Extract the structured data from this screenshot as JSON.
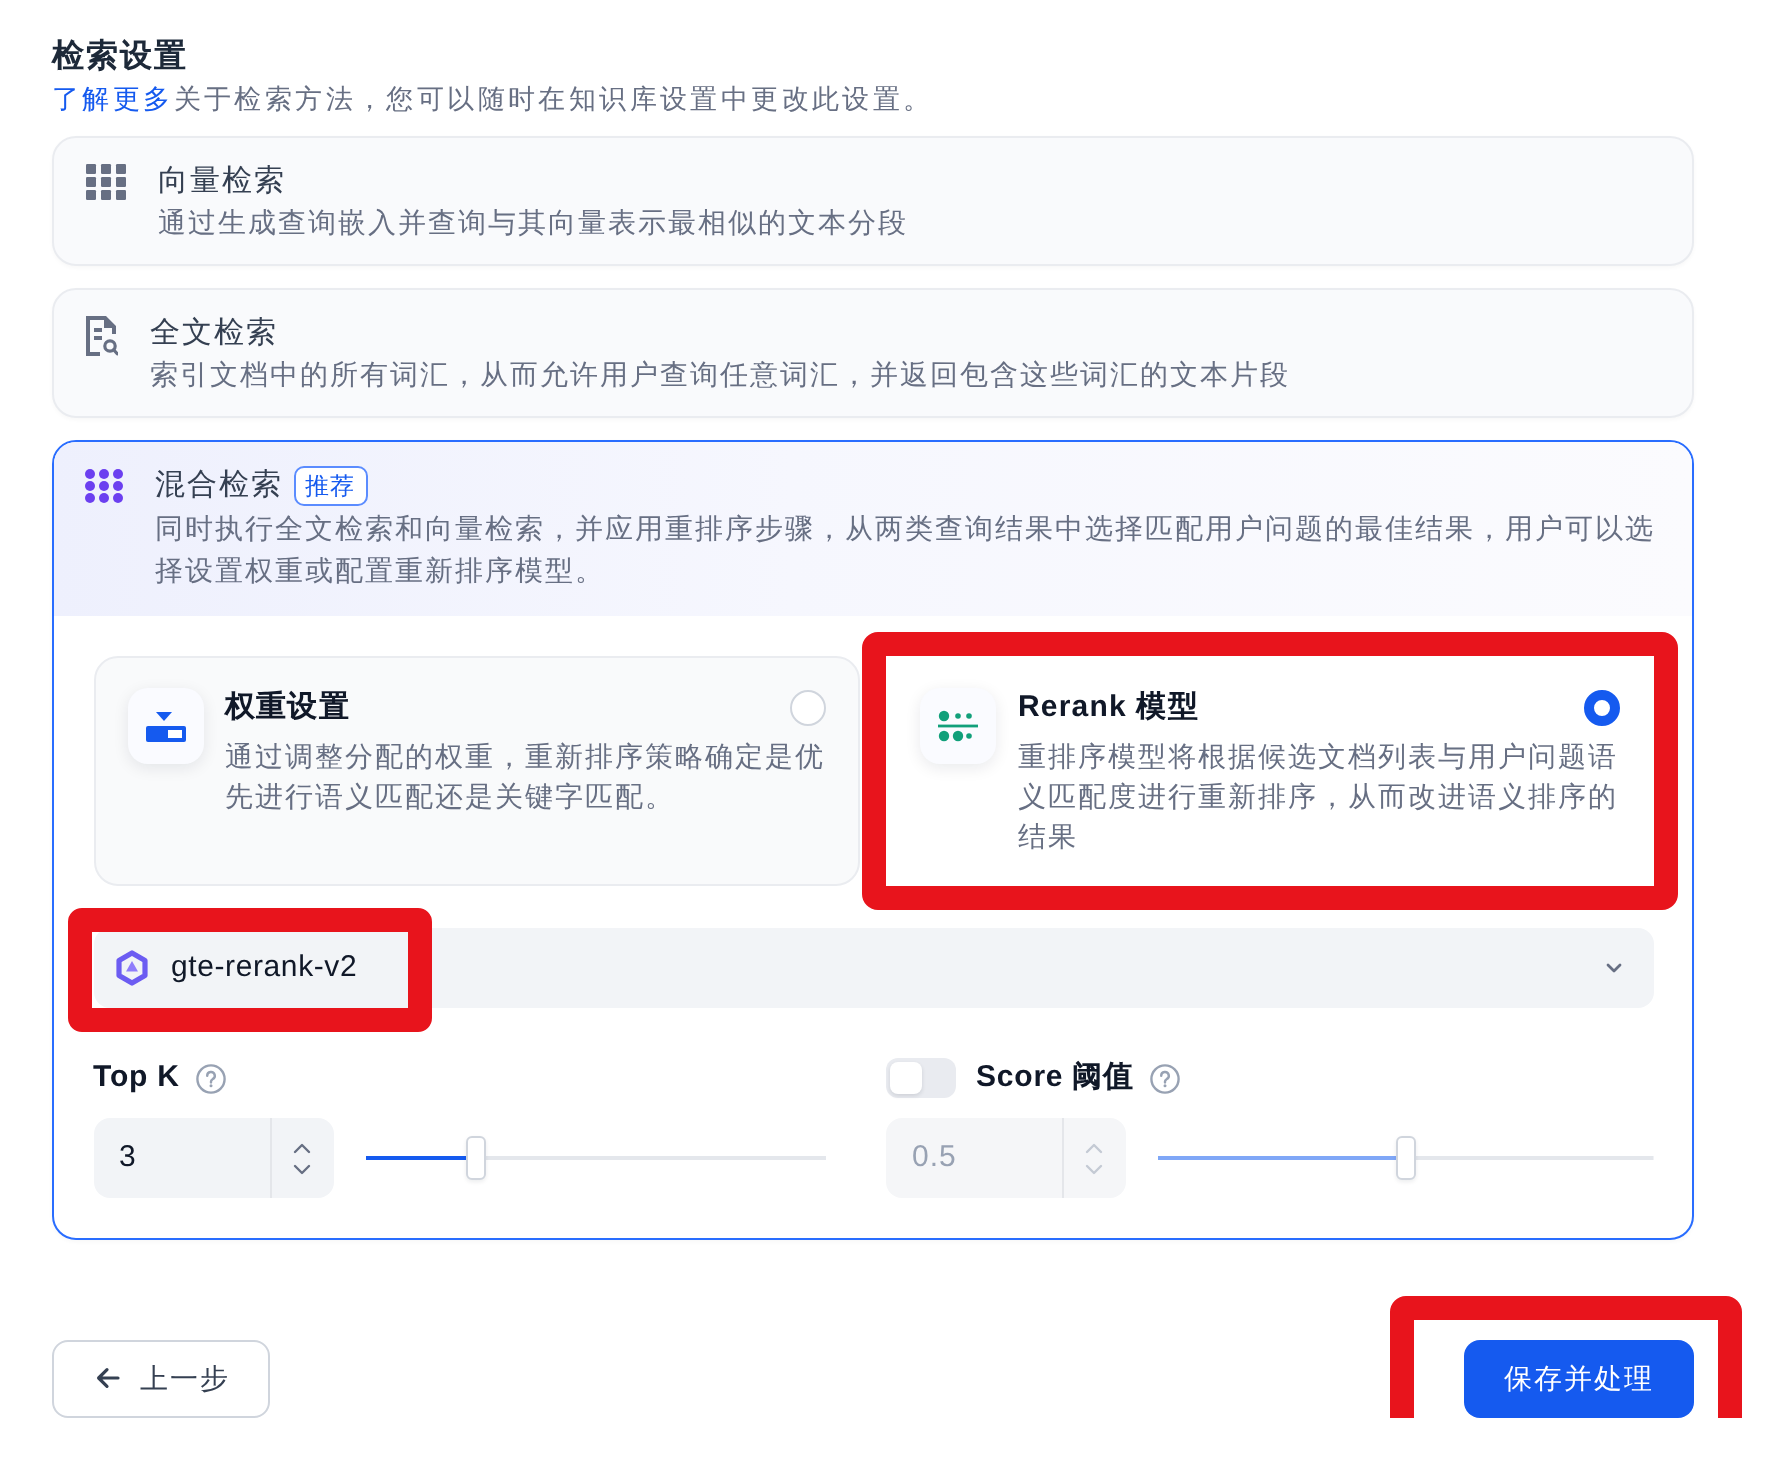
{
  "header": {
    "title": "检索设置",
    "link": "了解更多",
    "description": "关于检索方法，您可以随时在知识库设置中更改此设置。"
  },
  "methods": [
    {
      "kind": "vector",
      "title": "向量检索",
      "description": "通过生成查询嵌入并查询与其向量表示最相似的文本分段",
      "selected": false
    },
    {
      "kind": "fulltext",
      "title": "全文检索",
      "description": "索引文档中的所有词汇，从而允许用户查询任意词汇，并返回包含这些词汇的文本片段",
      "selected": false
    },
    {
      "kind": "hybrid",
      "title": "混合检索",
      "badge": "推荐",
      "description": "同时执行全文检索和向量检索，并应用重排序步骤，从两类查询结果中选择匹配用户问题的最佳结果，用户可以选择设置权重或配置重新排序模型。",
      "selected": true,
      "options": [
        {
          "kind": "weight",
          "title": "权重设置",
          "description": "通过调整分配的权重，重新排序策略确定是优先进行语义匹配还是关键字匹配。",
          "selected": false,
          "highlighted": false
        },
        {
          "kind": "rerank",
          "title": "Rerank 模型",
          "description": "重排序模型将根据候选文档列表与用户问题语义匹配度进行重新排序，从而改进语义排序的结果",
          "selected": true,
          "highlighted": true
        }
      ],
      "model_select": {
        "value": "gte-rerank-v2",
        "highlighted": true
      },
      "top_k": {
        "label": "Top K",
        "value": "3",
        "level": 0.23
      },
      "score_threshold": {
        "label": "Score 阈值",
        "on": false,
        "value": "0.5",
        "level": 0.5
      }
    }
  ],
  "actions": [
    {
      "kind": "back",
      "label": "上一步",
      "highlighted": false
    },
    {
      "kind": "primary",
      "label": "保存并处理",
      "highlighted": true
    }
  ]
}
